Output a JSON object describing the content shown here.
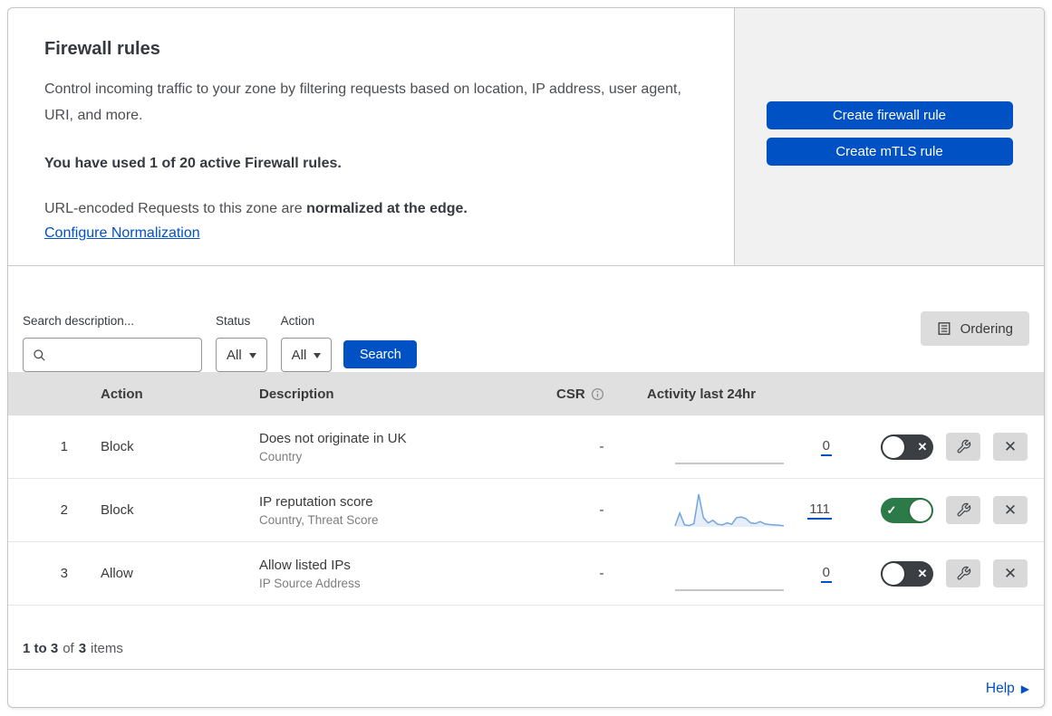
{
  "panel": {
    "title": "Firewall rules",
    "description": "Control incoming traffic to your zone by filtering requests based on location, IP address, user agent, URI, and more.",
    "usage_note": "You have used 1 of 20 active Firewall rules.",
    "normalization_text": "URL-encoded Requests to this zone are",
    "normalization_bold": "normalized at the edge.",
    "normalization_link": "Configure Normalization",
    "create_firewall_button": "Create firewall rule",
    "create_mtls_button": "Create mTLS rule"
  },
  "filters": {
    "search_label": "Search description...",
    "status_label": "Status",
    "status_value": "All",
    "action_label": "Action",
    "action_value": "All",
    "search_button": "Search",
    "ordering_button": "Ordering"
  },
  "table": {
    "columns": {
      "action": "Action",
      "description": "Description",
      "csr": "CSR",
      "activity": "Activity last 24hr"
    },
    "rows": [
      {
        "priority": "1",
        "action": "Block",
        "description": "Does not originate in UK",
        "match_fields": "Country",
        "csr": "-",
        "activity_count": "0",
        "enabled": false,
        "sparkline": [
          0,
          0
        ]
      },
      {
        "priority": "2",
        "action": "Block",
        "description": "IP reputation score",
        "match_fields": "Country, Threat Score",
        "csr": "-",
        "activity_count": "111",
        "enabled": true,
        "sparkline": [
          3,
          42,
          6,
          4,
          10,
          100,
          28,
          12,
          20,
          8,
          6,
          12,
          8,
          28,
          30,
          25,
          12,
          10,
          16,
          9,
          7,
          6,
          5,
          3
        ]
      },
      {
        "priority": "3",
        "action": "Allow",
        "description": "Allow listed IPs",
        "match_fields": "IP Source Address",
        "csr": "-",
        "activity_count": "0",
        "enabled": false,
        "sparkline": [
          0,
          0
        ]
      }
    ]
  },
  "footer": {
    "range": "1 to 3",
    "of": "of",
    "total": "3",
    "items": "items"
  },
  "help": {
    "label": "Help"
  },
  "icons": {
    "toggle_check": "✓",
    "toggle_x": "✕",
    "delete_x": "✕",
    "help_arrow": "▶"
  },
  "colors": {
    "accent_blue": "#0051c3",
    "toggle_on_green": "#2c7a47",
    "toggle_off_gray": "#3b3e42",
    "sparkline_stroke": "#74a6dd",
    "sparkline_fill": "rgba(116,166,221,0.18)",
    "sparkline_flat": "#b3b3b3",
    "table_header_bg": "#e0e0e0",
    "side_panel_bg": "#f1f1f2"
  }
}
